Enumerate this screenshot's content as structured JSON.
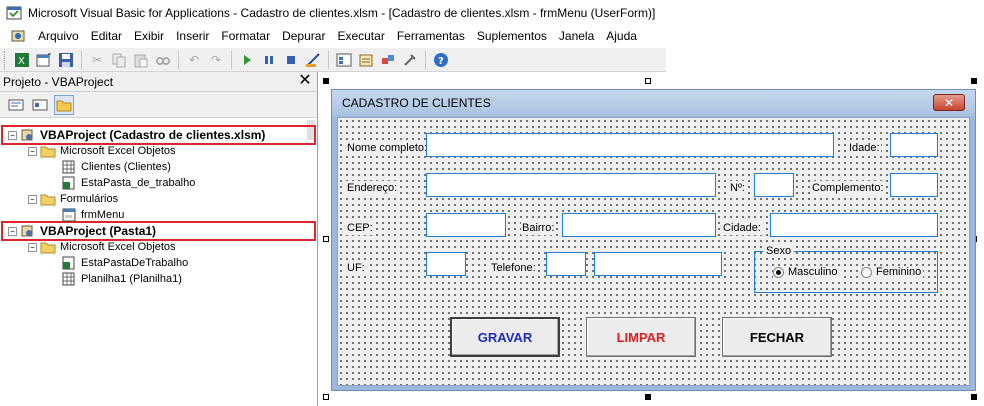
{
  "window": {
    "title": "Microsoft Visual Basic for Applications - Cadastro de clientes.xlsm - [Cadastro de clientes.xlsm - frmMenu (UserForm)]"
  },
  "menu": {
    "items": [
      "Arquivo",
      "Editar",
      "Exibir",
      "Inserir",
      "Formatar",
      "Depurar",
      "Executar",
      "Ferramentas",
      "Suplementos",
      "Janela",
      "Ajuda"
    ]
  },
  "toolbar": {
    "icons": [
      "excel-icon",
      "insert-userform-icon",
      "save-icon",
      "cut-icon",
      "copy-icon",
      "paste-icon",
      "find-icon",
      "undo-icon",
      "redo-icon",
      "run-icon",
      "break-icon",
      "reset-icon",
      "design-mode-icon",
      "project-explorer-icon",
      "properties-icon",
      "object-browser-icon",
      "toolbox-icon",
      "help-icon"
    ]
  },
  "project": {
    "title": "Projeto - VBAProject",
    "close": "✕",
    "tree": [
      {
        "label": "VBAProject (Cadastro de clientes.xlsm)",
        "level": 0,
        "expander": "−",
        "icon": "vbaproject-icon",
        "bold": true
      },
      {
        "label": "Microsoft Excel Objetos",
        "level": 1,
        "expander": "−",
        "icon": "folder-icon",
        "bold": false
      },
      {
        "label": "Clientes (Clientes)",
        "level": 2,
        "expander": "",
        "icon": "worksheet-icon",
        "bold": false
      },
      {
        "label": "EstaPasta_de_trabalho",
        "level": 2,
        "expander": "",
        "icon": "workbook-icon",
        "bold": false
      },
      {
        "label": "Formulários",
        "level": 1,
        "expander": "−",
        "icon": "folder-icon",
        "bold": false
      },
      {
        "label": "frmMenu",
        "level": 2,
        "expander": "",
        "icon": "userform-icon",
        "bold": false
      },
      {
        "label": "VBAProject (Pasta1)",
        "level": 0,
        "expander": "−",
        "icon": "vbaproject-icon",
        "bold": true
      },
      {
        "label": "Microsoft Excel Objetos",
        "level": 1,
        "expander": "−",
        "icon": "folder-icon",
        "bold": false
      },
      {
        "label": "EstaPastaDeTrabalho",
        "level": 2,
        "expander": "",
        "icon": "workbook-icon",
        "bold": false
      },
      {
        "label": "Planilha1 (Planilha1)",
        "level": 2,
        "expander": "",
        "icon": "worksheet-icon",
        "bold": false
      }
    ]
  },
  "form": {
    "caption": "CADASTRO DE CLIENTES",
    "close": "✕",
    "labels": {
      "nome": "Nome completo:",
      "idade": "Idade:",
      "endereco": "Endereço:",
      "numero": "Nº:",
      "complemento": "Complemento:",
      "cep": "CEP:",
      "bairro": "Bairro:",
      "cidade": "Cidade:",
      "uf": "UF:",
      "telefone": "Telefone:"
    },
    "sexo": {
      "title": "Sexo",
      "masculino": "Masculino",
      "feminino": "Feminino",
      "selected": "Masculino"
    },
    "buttons": {
      "gravar": {
        "label": "GRAVAR",
        "color": "#1f2dbf"
      },
      "limpar": {
        "label": "LIMPAR",
        "color": "#e11f1f"
      },
      "fechar": {
        "label": "FECHAR",
        "color": "#000000"
      }
    }
  },
  "colors": {
    "highlight": "#e0242b",
    "form_border": "#9cb9dd",
    "textbox_border": "#1e7fd0"
  }
}
